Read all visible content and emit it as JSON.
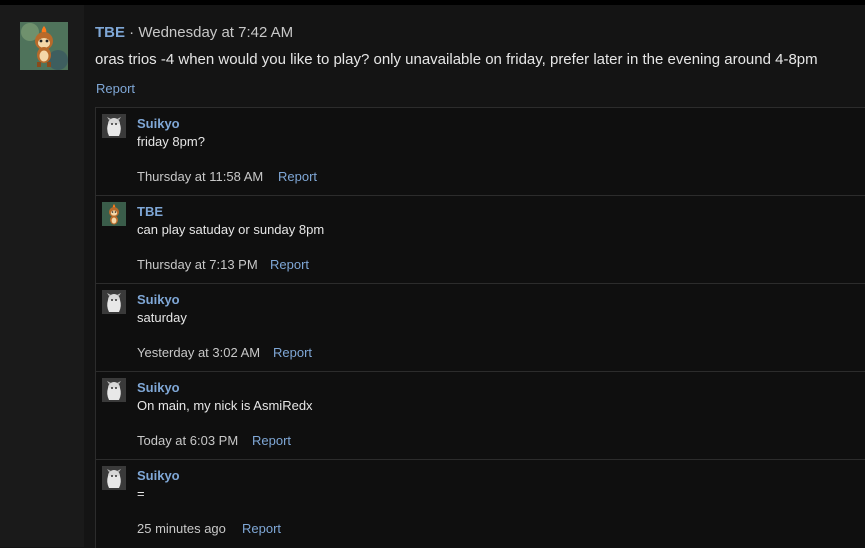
{
  "post": {
    "author": "TBE",
    "separator": " · ",
    "timestamp": "Wednesday at 7:42 AM",
    "body": "oras trios -4 when would you like to play? only unavailable on friday, prefer later in the evening around 4-8pm",
    "report_label": "Report",
    "avatar_icon": "monkey-fire-avatar-icon"
  },
  "replies": [
    {
      "author": "Suikyo",
      "text": "friday 8pm?",
      "timestamp": "Thursday at 11:58 AM",
      "report_label": "Report",
      "avatar_icon": "ghost-girl-avatar-icon"
    },
    {
      "author": "TBE",
      "text": "can play satuday or sunday 8pm",
      "timestamp": "Thursday at 7:13 PM",
      "report_label": "Report",
      "avatar_icon": "monkey-fire-avatar-icon"
    },
    {
      "author": "Suikyo",
      "text": "saturday",
      "timestamp": "Yesterday at 3:02 AM",
      "report_label": "Report",
      "avatar_icon": "ghost-girl-avatar-icon"
    },
    {
      "author": "Suikyo",
      "text": "On main, my nick is AsmiRedx",
      "timestamp": "Today at 6:03 PM",
      "report_label": "Report",
      "avatar_icon": "ghost-girl-avatar-icon"
    },
    {
      "author": "Suikyo",
      "text": "=",
      "timestamp": "25 minutes ago",
      "report_label": "Report",
      "avatar_icon": "ghost-girl-avatar-icon"
    }
  ],
  "colors": {
    "background": "#141414",
    "link": "#7fa7d6",
    "text": "#e6e6e6",
    "muted": "#c8c8c8"
  }
}
